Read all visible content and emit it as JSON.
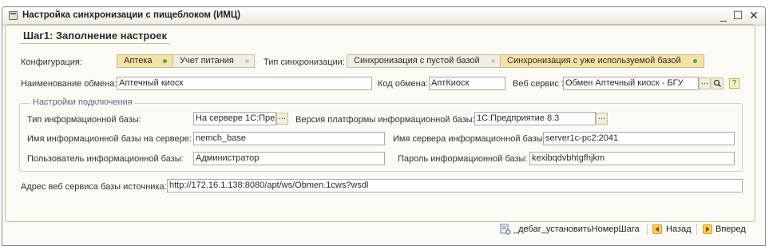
{
  "window": {
    "title": "Настройка синхронизации с пищеблоком (ИМЦ)",
    "minimize": "_",
    "maximize": "☐",
    "close": "✕"
  },
  "step": {
    "title": "Шаг1: Заполнение настроек"
  },
  "config": {
    "label": "Конфигурация:",
    "options": [
      {
        "label": "Аптека",
        "selected": true
      },
      {
        "label": "Учет питания",
        "selected": false
      }
    ]
  },
  "sync_type": {
    "label": "Тип синхронизации:",
    "options": [
      {
        "label": "Синхронизация с пустой базой",
        "selected": false
      },
      {
        "label": "Синхронизация с уже используемой базой",
        "selected": true
      }
    ]
  },
  "exchange": {
    "name_label": "Наименование обмена:",
    "name_value": "Аптечный киоск",
    "code_label": "Код обмена:",
    "code_value": "АптКиоск",
    "ws_label": "Веб сервис :",
    "ws_value": "Обмен Аптечный киоск - БГУ",
    "ws_select_button": "...",
    "help_button": "?"
  },
  "connection": {
    "group_title": "Настройки подключения",
    "db_type_label": "Тип информационной базы:",
    "db_type_value": "На сервере 1С:Пре...",
    "platform_label": "Версия платформы информационной базы:",
    "platform_value": "1С:Предприятие 8.3",
    "db_name_label": "Имя информационной базы на сервере:",
    "db_name_value": "nemch_base",
    "server_label": "Имя сервера информационной базы:",
    "server_value": "server1c-pc2:2041",
    "user_label": "Пользователь информационной базы:",
    "user_value": "Администратор",
    "password_label": "Пароль информационной базы:",
    "password_value": "kexibqdvbhtgfhjkm"
  },
  "source": {
    "label": "Адрес веб сервиса базы источника:",
    "value": "http://172.16.1.138:8080/apt/ws/Obmen.1cws?wsdl"
  },
  "footer": {
    "debug_label": "_дебаг_установитьНомерШага",
    "back_label": "Назад",
    "next_label": "Вперед"
  },
  "colors": {
    "accent_active": "#f6e2a4",
    "frame": "#c9c096",
    "indicator_on": "#4cae3c"
  }
}
